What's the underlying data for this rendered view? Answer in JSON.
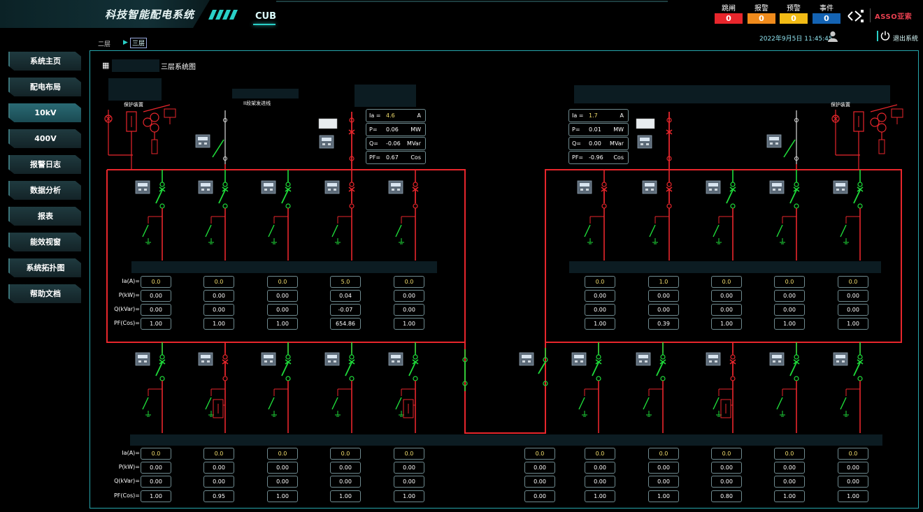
{
  "header": {
    "app_title": "科技智能配电系统",
    "tab": "CUB",
    "datetime": "2022年9月5日 11:45:45",
    "logo": "ASSO亚索",
    "logout": "退出系统"
  },
  "alarms": [
    {
      "label": "跳闸",
      "value": "0",
      "color": "#e8262c"
    },
    {
      "label": "报警",
      "value": "0",
      "color": "#f08b1c"
    },
    {
      "label": "预警",
      "value": "0",
      "color": "#f2bb15"
    },
    {
      "label": "事件",
      "value": "0",
      "color": "#1463b3"
    }
  ],
  "floors": {
    "floor2": "二层",
    "floor3": "三层"
  },
  "sidebar": [
    "系统主页",
    "配电布局",
    "10kV",
    "400V",
    "报警日志",
    "数据分析",
    "报表",
    "能效视窗",
    "系统拓扑图",
    "帮助文档"
  ],
  "panel": {
    "title": "三层系统图",
    "left_protect": "保护装置",
    "right_protect": "保护装置",
    "incoming_label": "II段架发进线"
  },
  "meters": {
    "left": [
      [
        "Ia =",
        "4.6",
        "A"
      ],
      [
        "P=",
        "0.06",
        "MW"
      ],
      [
        "Q=",
        "-0.06",
        "MVar"
      ],
      [
        "PF=",
        "0.67",
        "Cos"
      ]
    ],
    "right": [
      [
        "Ia =",
        "1.7",
        "A"
      ],
      [
        "P=",
        "0.01",
        "MW"
      ],
      [
        "Q=",
        "0.00",
        "MVar"
      ],
      [
        "PF=",
        "-0.96",
        "Cos"
      ]
    ]
  },
  "row_labels": [
    "Ia(A)=",
    "P(kW)=",
    "Q(kVar)=",
    "PF(Cos)="
  ],
  "upper_readings": [
    [
      "0.0",
      "0.00",
      "0.00",
      "1.00"
    ],
    [
      "0.0",
      "0.00",
      "0.00",
      "1.00"
    ],
    [
      "0.0",
      "0.00",
      "0.00",
      "1.00"
    ],
    [
      "5.0",
      "0.04",
      "-0.07",
      "654.86"
    ],
    [
      "0.0",
      "0.00",
      "0.00",
      "1.00"
    ],
    [
      "0.0",
      "0.00",
      "0.00",
      "1.00"
    ],
    [
      "1.0",
      "0.00",
      "0.00",
      "0.39"
    ],
    [
      "0.0",
      "0.00",
      "0.00",
      "1.00"
    ],
    [
      "0.0",
      "0.00",
      "0.00",
      "1.00"
    ],
    [
      "0.0",
      "0.00",
      "0.00",
      "1.00"
    ]
  ],
  "lower_readings": [
    [
      "0.0",
      "0.00",
      "0.00",
      "1.00"
    ],
    [
      "0.0",
      "0.00",
      "0.00",
      "0.95"
    ],
    [
      "0.0",
      "0.00",
      "0.00",
      "1.00"
    ],
    [
      "0.0",
      "0.00",
      "0.00",
      "1.00"
    ],
    [
      "0.0",
      "0.00",
      "0.00",
      "1.00"
    ],
    [
      "0.0",
      "0.00",
      "0.00",
      "0.00"
    ],
    [
      "0.0",
      "0.00",
      "0.00",
      "1.00"
    ],
    [
      "0.0",
      "0.00",
      "0.00",
      "1.00"
    ],
    [
      "0.0",
      "0.00",
      "0.00",
      "0.80"
    ],
    [
      "0.0",
      "0.00",
      "0.00",
      "1.00"
    ],
    [
      "0.0",
      "0.00",
      "0.00",
      "1.00"
    ]
  ],
  "colors": {
    "accent": "#2ad0c8",
    "live": "#e8262c",
    "off": "#1fdc3a",
    "value": "#f3df6e"
  }
}
